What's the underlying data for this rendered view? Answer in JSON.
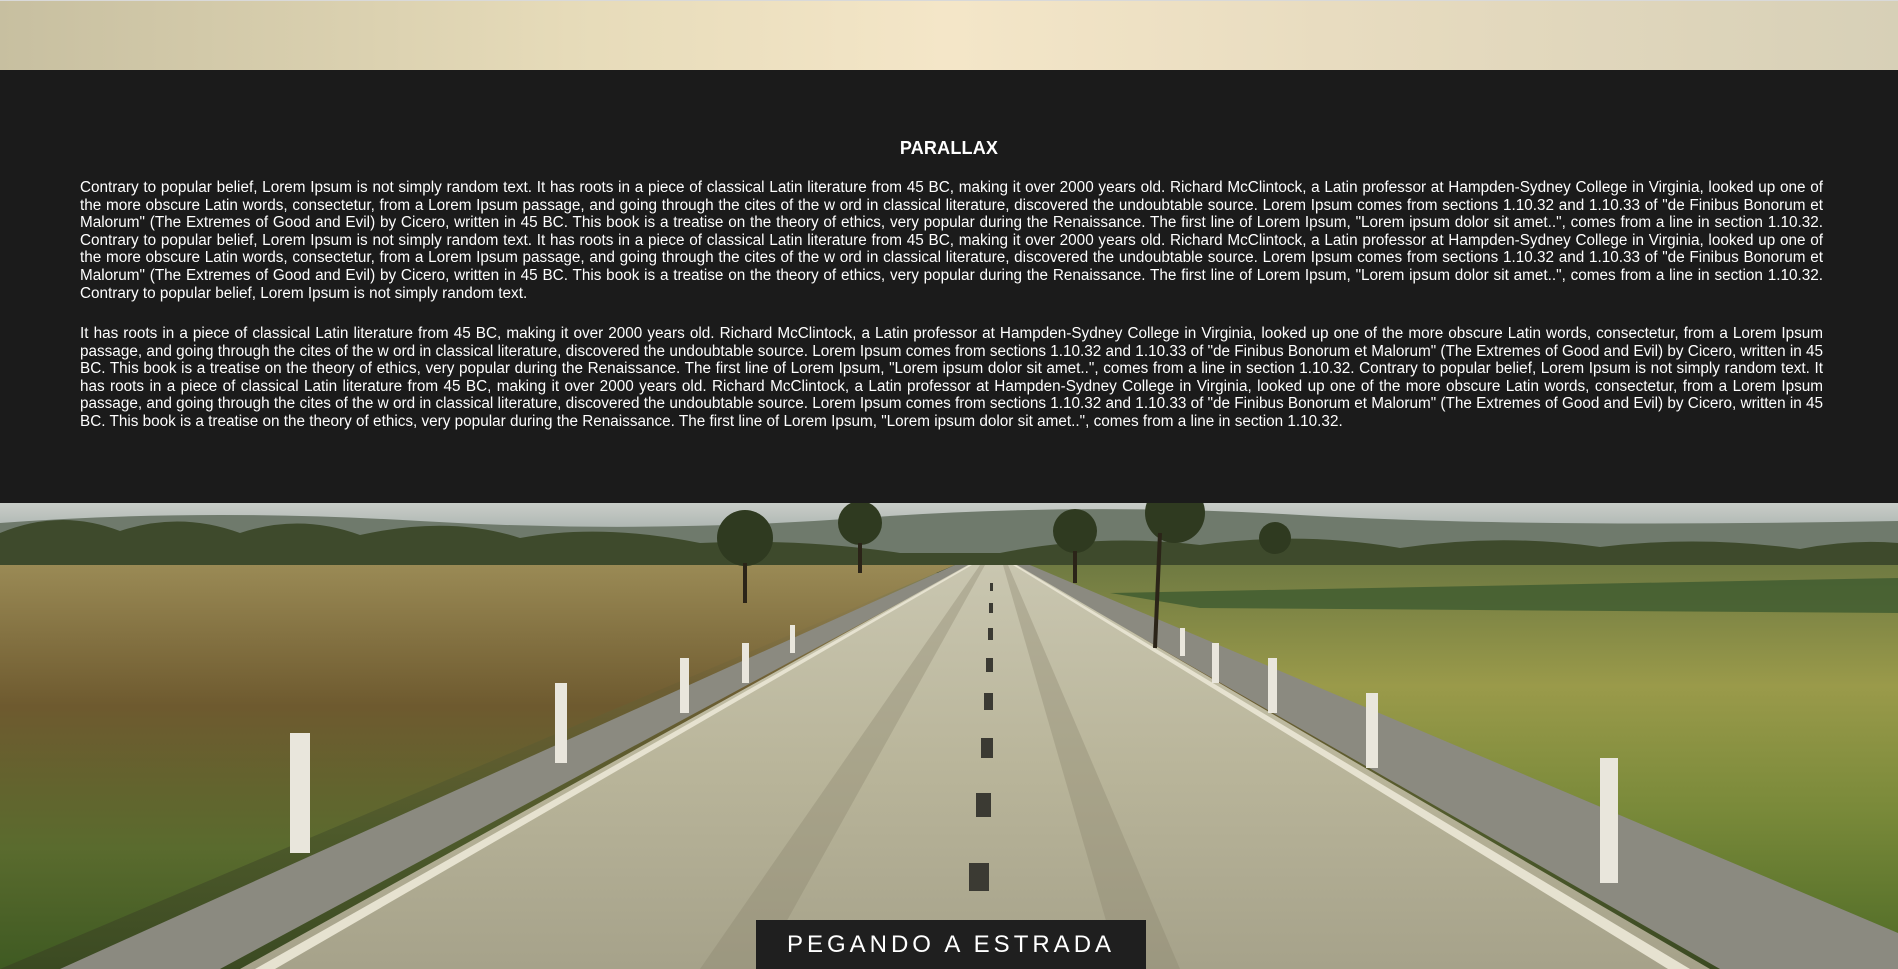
{
  "section": {
    "title": "PARALLAX",
    "paragraphs": [
      "Contrary to popular belief, Lorem Ipsum is not simply random text. It has roots in a piece of classical Latin literature from 45 BC, making it over 2000 years old. Richard McClintock, a Latin professor at Hampden-Sydney College in Virginia, looked up one of the more obscure Latin words, consectetur, from a Lorem Ipsum passage, and going through the cites of the w ord in classical literature, discovered the undoubtable source. Lorem Ipsum comes from sections 1.10.32 and 1.10.33 of \"de Finibus Bonorum et Malorum\" (The Extremes of Good and Evil) by Cicero, written in 45 BC. This book is a treatise on the theory of ethics, very popular during the Renaissance. The first line of Lorem Ipsum, \"Lorem ipsum dolor sit amet..\", comes from a line in section 1.10.32. Contrary to popular belief, Lorem Ipsum is not simply random text. It has roots in a piece of classical Latin literature from 45 BC, making it over 2000 years old. Richard McClintock, a Latin professor at Hampden-Sydney College in Virginia, looked up one of the more obscure Latin words, consectetur, from a Lorem Ipsum passage, and going through the cites of the w ord in classical literature, discovered the undoubtable source. Lorem Ipsum comes from sections 1.10.32 and 1.10.33 of \"de Finibus Bonorum et Malorum\" (The Extremes of Good and Evil) by Cicero, written in 45 BC. This book is a treatise on the theory of ethics, very popular during the Renaissance. The first line of Lorem Ipsum, \"Lorem ipsum dolor sit amet..\", comes from a line in section 1.10.32. Contrary to popular belief, Lorem Ipsum is not simply random text.",
      "It has roots in a piece of classical Latin literature from 45 BC, making it over 2000 years old. Richard McClintock, a Latin professor at Hampden-Sydney College in Virginia, looked up one of the more obscure Latin words, consectetur, from a Lorem Ipsum passage, and going through the cites of the w ord in classical literature, discovered the undoubtable source. Lorem Ipsum comes from sections 1.10.32 and 1.10.33 of \"de Finibus Bonorum et Malorum\" (The Extremes of Good and Evil) by Cicero, written in 45 BC. This book is a treatise on the theory of ethics, very popular during the Renaissance. The first line of Lorem Ipsum, \"Lorem ipsum dolor sit amet..\", comes from a line in section 1.10.32. Contrary to popular belief, Lorem Ipsum is not simply random text. It has roots in a piece of classical Latin literature from 45 BC, making it over 2000 years old. Richard McClintock, a Latin professor at Hampden-Sydney College in Virginia, looked up one of the more obscure Latin words, consectetur, from a Lorem Ipsum passage, and going through the cites of the w ord in classical literature, discovered the undoubtable source. Lorem Ipsum comes from sections 1.10.32 and 1.10.33 of \"de Finibus Bonorum et Malorum\" (The Extremes of Good and Evil) by Cicero, written in 45 BC. This book is a treatise on the theory of ethics, very popular during the Renaissance. The first line of Lorem Ipsum, \"Lorem ipsum dolor sit amet..\", comes from a line in section 1.10.32."
    ]
  },
  "hero": {
    "caption": "PEGANDO A ESTRADA"
  },
  "colors": {
    "section_background": "#1b1b1b",
    "text": "#ffffff",
    "caption_background": "#1f1f1f"
  }
}
